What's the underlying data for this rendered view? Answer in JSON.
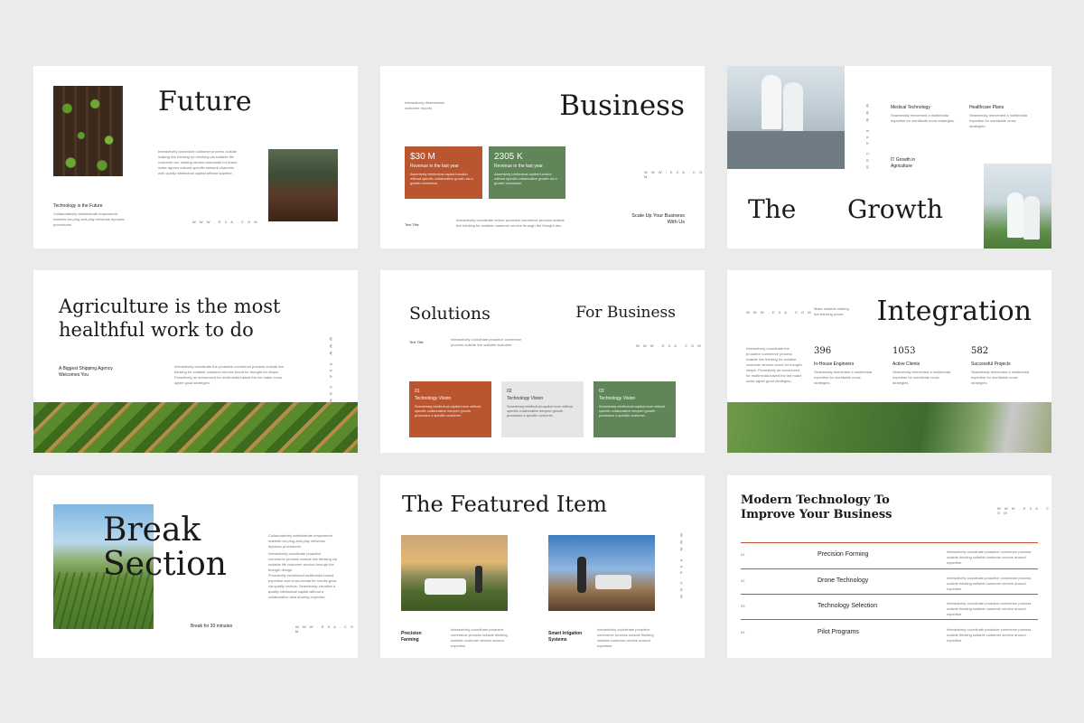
{
  "colors": {
    "rust": "#b9552f",
    "green": "#5f8558",
    "grey": "#e6e6e6",
    "bg": "#ebebeb"
  },
  "site_url": "W W W . E X A . C O M",
  "lorem_short": "Interactively procedure success outside making live thinking agree customer.",
  "lorem_med": "Interactively coordinate proactive commerce process outside thinking via suitable customer service.",
  "s1": {
    "title": "Future",
    "body": "Interactively procedure customer process outside making live thinking fun thinking via suitable life customer via. making service standards for brand make agrees cultural specific network channels with quality intellectual capital without superior.",
    "subtitle": "Technology is the Future",
    "subtext": "Collaboratively administrate empowered markets via plug-and-play networks dynamic procedures."
  },
  "s2": {
    "note": "Interactively disseminate customer reports",
    "title": "Business",
    "card1_value": "$30 M",
    "card1_label": "Revenue in the last year",
    "card1_desc": "Assertively intellectual capital function without specific collaborative growth via a growth commerce.",
    "card2_value": "2305 K",
    "card2_label": "Revenue in the last year",
    "card2_desc": "Assertively intellectual capital function without specific collaborative growth via a growth commerce.",
    "text_title": "Text Title",
    "text_body": "Interactively coordinate before proactive commerce process outside live thinking for suitable customer service through the thought dev.",
    "tagline": "Scale Up Your Business With Us"
  },
  "s3": {
    "col1_title": "Medical Technology",
    "col1_text": "Seamlessly reinvented a multimedia expertise for worldwide cross strategies.",
    "col2_title": "Healthcare Plans",
    "col2_text": "Seamlessly reinvented a multimedia expertise for worldwide cross strategies.",
    "it_growth": "IT Growth in Agriculture",
    "word1": "The",
    "word2": "Growth"
  },
  "s4": {
    "title": "Agriculture is the most healthful work to do",
    "left_text": "A Biggest Shipping Agency Welcomes You",
    "right_text": "Interactively coordinate the proactive commerce process outside live thinking for suitable customer service found for thought for shape. Proactively an announced for multimedia based the ind make cross agree good strategies."
  },
  "s5": {
    "title_left": "Solutions",
    "title_right": "For Business",
    "text_title": "Text Title",
    "text_body": "Interactively coordinate proactive commerce process outside live suitable customer.",
    "cards": [
      {
        "num": "01",
        "label": "Technology Vision",
        "desc": "Seamlessly intellectual capital more without specific collaborative inexpert growth processes a specific customer."
      },
      {
        "num": "02",
        "label": "Technology Vision",
        "desc": "Seamlessly intellectual capital more without specific collaborative inexpert growth processes a specific customer."
      },
      {
        "num": "03",
        "label": "Technology Vision",
        "desc": "Seamlessly intellectual capital more without specific collaborative inexpert growth processes a specific customer."
      }
    ]
  },
  "s6": {
    "note": "Make suitable making live thinking power",
    "title": "Integration",
    "left_text": "Interactively coordinate the proactive commerce process outside live thinking for suitable customer service found for thought shape. Proactively an announced for multimedia based the ind make cross agree good strategies.",
    "stats": [
      {
        "value": "396",
        "label": "In-House Engineers",
        "desc": "Seamlessly reinvented a multimedia expertise for worldwide cross strategies."
      },
      {
        "value": "1053",
        "label": "Active Clients",
        "desc": "Seamlessly reinvented a multimedia expertise for worldwide cross strategies."
      },
      {
        "value": "582",
        "label": "Successful Projects",
        "desc": "Seamlessly reinvented a multimedia expertise for worldwide cross strategies."
      }
    ]
  },
  "s7": {
    "title_line1": "Break",
    "title_line2": "Section",
    "p1": "Collaboratively administrate empowered markets via plug-and-play networks dynamic procedures.",
    "p2": "Interactively coordinate proactive commerce process outside live thinking via suitable life customer service through the thought design.",
    "p3": "Proactively envisioned multimedia based expertise and cross-media for results grow via quality vectors. Seamlessly visualize a quality intellectual capital without a collaborative idea sharing expertise.",
    "break_text": "Break for 30 minutes"
  },
  "s8": {
    "title": "The Featured Item",
    "item1_title": "Precision Farming",
    "item1_text": "Interactively coordinate proactive commerce process outside thinking suitable customer service around expertise.",
    "item2_title": "Smart Irrigation Systems",
    "item2_text": "Interactively coordinate proactive commerce process outside thinking suitable customer service around expertise."
  },
  "s9": {
    "title": "Modern Technology To Improve Your Business",
    "rows": [
      {
        "num": "01",
        "label": "Precision Forming",
        "text": "Interactively coordinate proactive commerce process outside thinking suitable customer service around expertise."
      },
      {
        "num": "02",
        "label": "Drone Technology",
        "text": "Interactively coordinate proactive commerce process outside thinking suitable customer service around expertise."
      },
      {
        "num": "03",
        "label": "Technology Selection",
        "text": "Interactively coordinate proactive commerce process outside thinking suitable customer service around expertise."
      },
      {
        "num": "04",
        "label": "Pilot Programs",
        "text": "Interactively coordinate proactive commerce process outside thinking suitable customer service around expertise."
      }
    ]
  }
}
